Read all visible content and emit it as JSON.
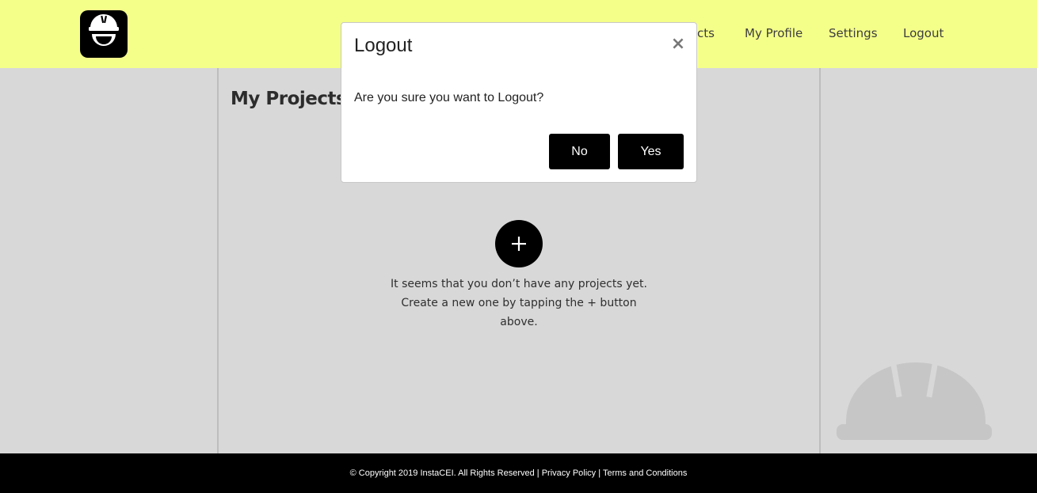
{
  "header": {
    "background_color": "#f4ff8a",
    "logo_icon": "hardhat-smile-icon",
    "nav": {
      "projects_label_partial": "cts",
      "profile_label": "My Profile",
      "settings_label": "Settings",
      "logout_label": "Logout"
    }
  },
  "main": {
    "page_title": "My Projects",
    "add_button_icon": "plus-icon",
    "empty_message": "It seems that you don’t have any projects yet. Create a new one by tapping the + button above.",
    "decor_icon": "hardhat-icon"
  },
  "modal": {
    "title": "Logout",
    "close_symbol": "×",
    "message": "Are you sure you want to Logout?",
    "no_label": "No",
    "yes_label": "Yes"
  },
  "footer": {
    "copyright": "© Copyright 2019 InstaCEI. All Rights Reserved",
    "separator": " | ",
    "privacy_label": "Privacy Policy",
    "terms_label": "Terms and Conditions"
  }
}
